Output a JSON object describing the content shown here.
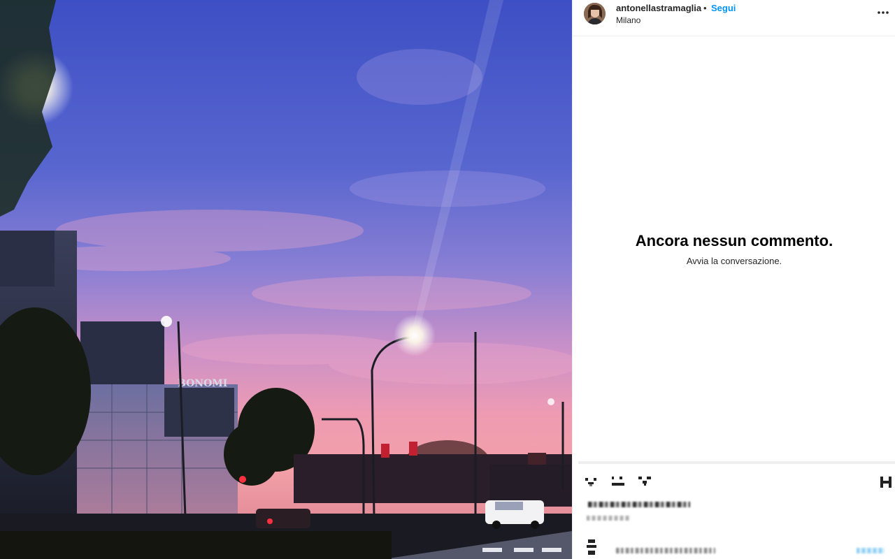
{
  "post": {
    "username": "antonellastramaglia",
    "separator": "•",
    "follow_label": "Segui",
    "location": "Milano"
  },
  "photo": {
    "sign_text": "BONOMI"
  },
  "comments": {
    "empty_title": "Ancora nessun commento.",
    "empty_subtitle": "Avvia la conversazione."
  },
  "icons": {
    "more": "more-options-icon",
    "like": "heart-icon",
    "comment": "comment-icon",
    "share": "share-icon",
    "save": "bookmark-icon"
  },
  "colors": {
    "link": "#0095f6",
    "border": "#efefef",
    "sky_top": "#4a5fd0",
    "sky_pink": "#e48aa6"
  }
}
